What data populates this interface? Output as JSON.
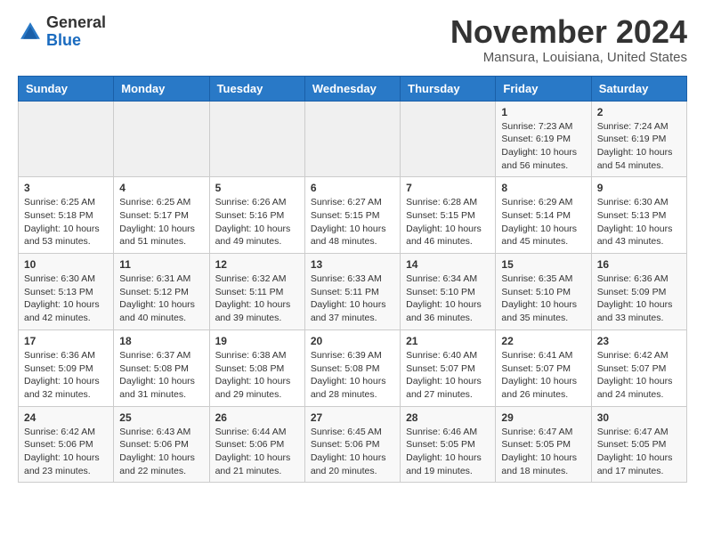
{
  "logo": {
    "general": "General",
    "blue": "Blue"
  },
  "title": "November 2024",
  "location": "Mansura, Louisiana, United States",
  "days_of_week": [
    "Sunday",
    "Monday",
    "Tuesday",
    "Wednesday",
    "Thursday",
    "Friday",
    "Saturday"
  ],
  "weeks": [
    [
      {
        "day": "",
        "info": ""
      },
      {
        "day": "",
        "info": ""
      },
      {
        "day": "",
        "info": ""
      },
      {
        "day": "",
        "info": ""
      },
      {
        "day": "",
        "info": ""
      },
      {
        "day": "1",
        "info": "Sunrise: 7:23 AM\nSunset: 6:19 PM\nDaylight: 10 hours and 56 minutes."
      },
      {
        "day": "2",
        "info": "Sunrise: 7:24 AM\nSunset: 6:19 PM\nDaylight: 10 hours and 54 minutes."
      }
    ],
    [
      {
        "day": "3",
        "info": "Sunrise: 6:25 AM\nSunset: 5:18 PM\nDaylight: 10 hours and 53 minutes."
      },
      {
        "day": "4",
        "info": "Sunrise: 6:25 AM\nSunset: 5:17 PM\nDaylight: 10 hours and 51 minutes."
      },
      {
        "day": "5",
        "info": "Sunrise: 6:26 AM\nSunset: 5:16 PM\nDaylight: 10 hours and 49 minutes."
      },
      {
        "day": "6",
        "info": "Sunrise: 6:27 AM\nSunset: 5:15 PM\nDaylight: 10 hours and 48 minutes."
      },
      {
        "day": "7",
        "info": "Sunrise: 6:28 AM\nSunset: 5:15 PM\nDaylight: 10 hours and 46 minutes."
      },
      {
        "day": "8",
        "info": "Sunrise: 6:29 AM\nSunset: 5:14 PM\nDaylight: 10 hours and 45 minutes."
      },
      {
        "day": "9",
        "info": "Sunrise: 6:30 AM\nSunset: 5:13 PM\nDaylight: 10 hours and 43 minutes."
      }
    ],
    [
      {
        "day": "10",
        "info": "Sunrise: 6:30 AM\nSunset: 5:13 PM\nDaylight: 10 hours and 42 minutes."
      },
      {
        "day": "11",
        "info": "Sunrise: 6:31 AM\nSunset: 5:12 PM\nDaylight: 10 hours and 40 minutes."
      },
      {
        "day": "12",
        "info": "Sunrise: 6:32 AM\nSunset: 5:11 PM\nDaylight: 10 hours and 39 minutes."
      },
      {
        "day": "13",
        "info": "Sunrise: 6:33 AM\nSunset: 5:11 PM\nDaylight: 10 hours and 37 minutes."
      },
      {
        "day": "14",
        "info": "Sunrise: 6:34 AM\nSunset: 5:10 PM\nDaylight: 10 hours and 36 minutes."
      },
      {
        "day": "15",
        "info": "Sunrise: 6:35 AM\nSunset: 5:10 PM\nDaylight: 10 hours and 35 minutes."
      },
      {
        "day": "16",
        "info": "Sunrise: 6:36 AM\nSunset: 5:09 PM\nDaylight: 10 hours and 33 minutes."
      }
    ],
    [
      {
        "day": "17",
        "info": "Sunrise: 6:36 AM\nSunset: 5:09 PM\nDaylight: 10 hours and 32 minutes."
      },
      {
        "day": "18",
        "info": "Sunrise: 6:37 AM\nSunset: 5:08 PM\nDaylight: 10 hours and 31 minutes."
      },
      {
        "day": "19",
        "info": "Sunrise: 6:38 AM\nSunset: 5:08 PM\nDaylight: 10 hours and 29 minutes."
      },
      {
        "day": "20",
        "info": "Sunrise: 6:39 AM\nSunset: 5:08 PM\nDaylight: 10 hours and 28 minutes."
      },
      {
        "day": "21",
        "info": "Sunrise: 6:40 AM\nSunset: 5:07 PM\nDaylight: 10 hours and 27 minutes."
      },
      {
        "day": "22",
        "info": "Sunrise: 6:41 AM\nSunset: 5:07 PM\nDaylight: 10 hours and 26 minutes."
      },
      {
        "day": "23",
        "info": "Sunrise: 6:42 AM\nSunset: 5:07 PM\nDaylight: 10 hours and 24 minutes."
      }
    ],
    [
      {
        "day": "24",
        "info": "Sunrise: 6:42 AM\nSunset: 5:06 PM\nDaylight: 10 hours and 23 minutes."
      },
      {
        "day": "25",
        "info": "Sunrise: 6:43 AM\nSunset: 5:06 PM\nDaylight: 10 hours and 22 minutes."
      },
      {
        "day": "26",
        "info": "Sunrise: 6:44 AM\nSunset: 5:06 PM\nDaylight: 10 hours and 21 minutes."
      },
      {
        "day": "27",
        "info": "Sunrise: 6:45 AM\nSunset: 5:06 PM\nDaylight: 10 hours and 20 minutes."
      },
      {
        "day": "28",
        "info": "Sunrise: 6:46 AM\nSunset: 5:05 PM\nDaylight: 10 hours and 19 minutes."
      },
      {
        "day": "29",
        "info": "Sunrise: 6:47 AM\nSunset: 5:05 PM\nDaylight: 10 hours and 18 minutes."
      },
      {
        "day": "30",
        "info": "Sunrise: 6:47 AM\nSunset: 5:05 PM\nDaylight: 10 hours and 17 minutes."
      }
    ]
  ]
}
